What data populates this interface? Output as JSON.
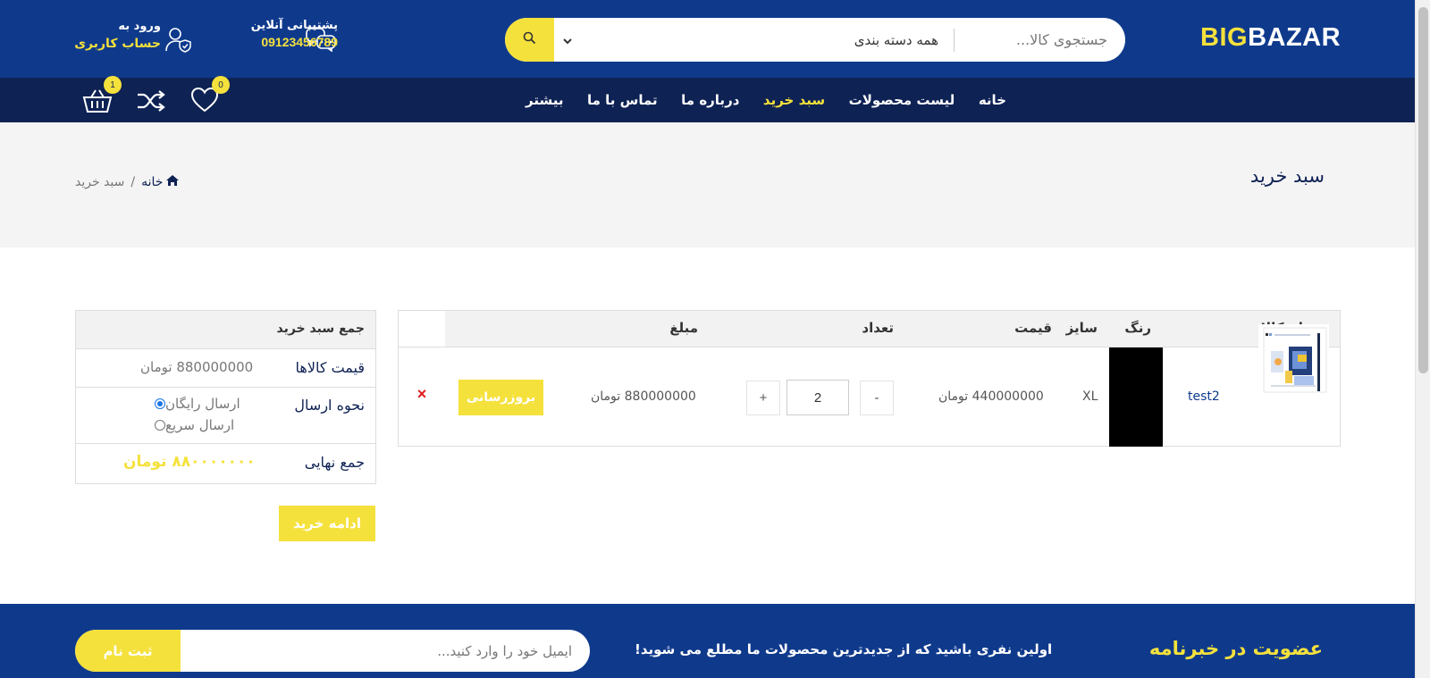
{
  "colors": {
    "primary": "#0f3a8c",
    "nav": "#0e2254",
    "accent": "#f5e13c",
    "remove": "#e01b1b"
  },
  "header": {
    "logo_part1": "BIG",
    "logo_part2": "BAZAR",
    "search_placeholder": "جستجوی کالا...",
    "category_selected": "همه دسته بندی",
    "support_label": "پشتیبانی آنلاین",
    "support_phone": "09123456789",
    "account_line1": "ورود به",
    "account_line2": "حساب کاربری"
  },
  "nav": {
    "items": [
      {
        "label": "خانه"
      },
      {
        "label": "لیست محصولات"
      },
      {
        "label": "سبد خرید"
      },
      {
        "label": "درباره ما"
      },
      {
        "label": "تماس با ما"
      },
      {
        "label": "بیشتر"
      }
    ],
    "wishlist_count": "0",
    "cart_count": "1"
  },
  "banner": {
    "title": "سبد خرید",
    "breadcrumb_home": "خانه",
    "breadcrumb_sep": "/",
    "breadcrumb_current": "سبد خرید"
  },
  "cart": {
    "headers": {
      "name": "نام کالا",
      "color": "رنگ",
      "size": "سایز",
      "price": "قیمت",
      "qty": "تعداد",
      "amount": "مبلغ"
    },
    "item": {
      "name": "test2",
      "size": "XL",
      "price": "440000000 تومان",
      "qty": "2",
      "qty_minus": "-",
      "qty_plus": "+",
      "amount": "880000000 تومان",
      "update_label": "بروزرسانی",
      "remove_symbol": "×",
      "color_value": "#000000"
    }
  },
  "summary": {
    "title": "جمع سبد خرید",
    "items_price_label": "قیمت کالاها",
    "items_price_value": "880000000 تومان",
    "shipping_label": "نحوه ارسال",
    "shipping_options": [
      {
        "label": "ارسال رایگان",
        "selected": true
      },
      {
        "label": "ارسال سریع",
        "selected": false
      }
    ],
    "total_label": "جمع نهایی",
    "total_value": "۸۸۰۰۰۰۰۰۰ تومان",
    "continue_label": "ادامه خرید"
  },
  "newsletter": {
    "title": "عضویت در خبرنامه",
    "text": "اولین نفری باشید که از جدیدترین محصولات ما مطلع می شوید!",
    "placeholder": "ایمیل خود را وارد کنید...",
    "button": "ثبت نام"
  }
}
